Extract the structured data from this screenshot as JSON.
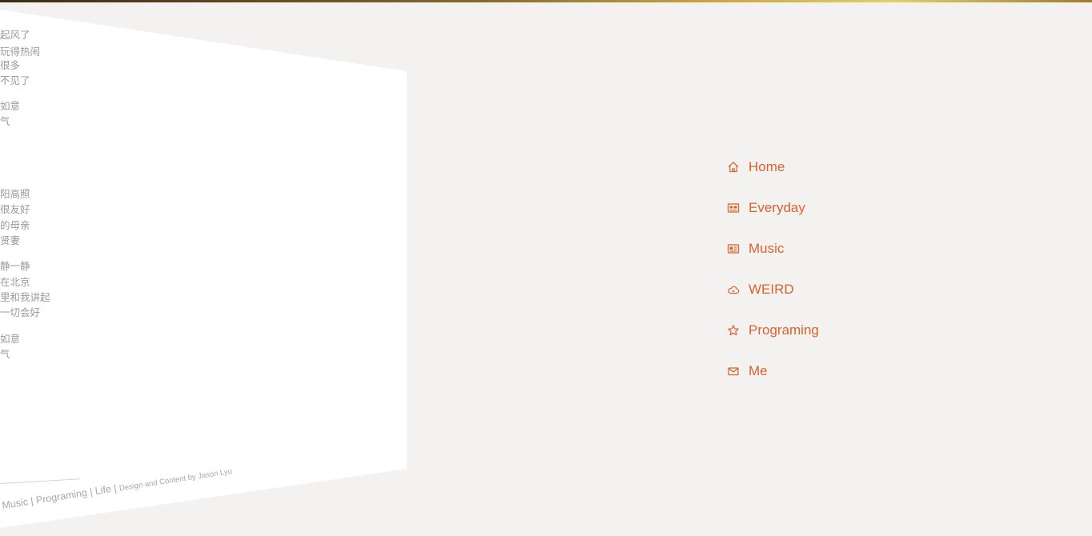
{
  "lyrics": [
    "起风了",
    "玩得热闹",
    "很多",
    "不见了",
    "如意",
    "气",
    "阳高照",
    "很友好",
    "的母亲",
    "贤妻",
    "静一静",
    "在北京",
    "里和我讲起",
    "一切会好",
    "如意",
    "气"
  ],
  "footer": {
    "main": "Music | Programing | Life | ",
    "credit": "Design and Content by Jason Lyu"
  },
  "nav": {
    "items": [
      {
        "label": "Home",
        "icon": "home-icon"
      },
      {
        "label": "Everyday",
        "icon": "calendar-card-icon"
      },
      {
        "label": "Music",
        "icon": "music-card-icon"
      },
      {
        "label": "WEIRD",
        "icon": "cloud-icon"
      },
      {
        "label": "Programing",
        "icon": "star-icon"
      },
      {
        "label": "Me",
        "icon": "mail-icon"
      }
    ]
  },
  "colors": {
    "background": "#f3f2f0",
    "panel": "#ffffff",
    "accent": "#d9622b",
    "lyric_text": "#9a9a9a"
  }
}
